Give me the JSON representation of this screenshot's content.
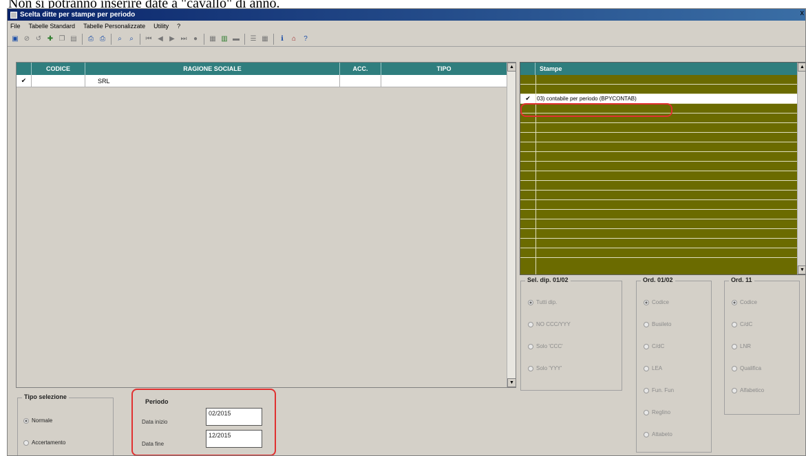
{
  "doc_text": "Non si potranno inserire date a \"cavallo\" di anno.",
  "window": {
    "title": "Scelta ditte per stampe per periodo",
    "close": "x"
  },
  "menu": [
    "File",
    "Tabelle Standard",
    "Tabelle Personalizzate",
    "Utility",
    "?"
  ],
  "grid": {
    "columns": [
      "CODICE",
      "RAGIONE SOCIALE",
      "ACC.",
      "TIPO"
    ],
    "rows": [
      {
        "check": "✔",
        "codice": "",
        "ragione": "SRL",
        "acc": "",
        "tipo": ""
      }
    ]
  },
  "stampe": {
    "header": "Stampe",
    "selected_item": "03) contabile per periodo (BPYCONTAB)",
    "check": "✔"
  },
  "sel_dip": {
    "title": "Sel. dip. 01/02",
    "options": [
      "Tutti dip.",
      "NO CCC/YYY",
      "Solo 'CCC'",
      "Solo 'YYY'"
    ]
  },
  "ord_0102": {
    "title": "Ord. 01/02",
    "options": [
      "Codice",
      "Busileto",
      "C/dC",
      "LEA",
      "Fun. Fun",
      "Reglino",
      "Attabeto"
    ]
  },
  "ord_11": {
    "title": "Ord. 11",
    "options": [
      "Codice",
      "C/dC",
      "LNR",
      "Qualifica",
      "Alfabetico"
    ]
  },
  "tipo_selezione": {
    "title": "Tipo selezione",
    "options": [
      "Normale",
      "Accertamento"
    ]
  },
  "periodo": {
    "title": "Periodo",
    "data_inizio_label": "Data inizio",
    "data_inizio": "02/2015",
    "data_fine_label": "Data fine",
    "data_fine": "12/2015"
  },
  "colors": {
    "teal_header": "#2f7e7e",
    "olive": "#6b6b00",
    "highlight": "#e03030"
  }
}
